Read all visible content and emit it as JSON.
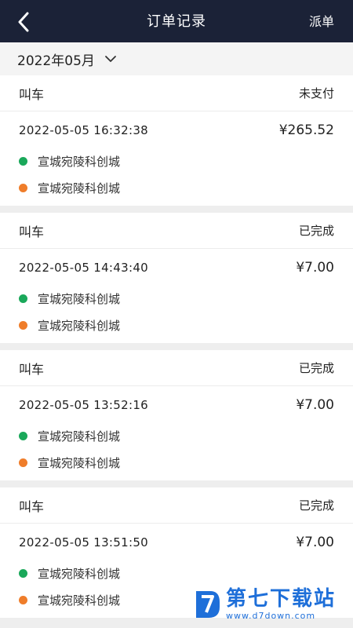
{
  "header": {
    "title": "订单记录",
    "action_label": "派单"
  },
  "month_filter": {
    "label": "2022年05月"
  },
  "orders": [
    {
      "type": "叫车",
      "status": "未支付",
      "time": "2022-05-05 16:32:38",
      "price": "¥265.52",
      "origin": "宣城宛陵科创城",
      "destination": "宣城宛陵科创城"
    },
    {
      "type": "叫车",
      "status": "已完成",
      "time": "2022-05-05 14:43:40",
      "price": "¥7.00",
      "origin": "宣城宛陵科创城",
      "destination": "宣城宛陵科创城"
    },
    {
      "type": "叫车",
      "status": "已完成",
      "time": "2022-05-05 13:52:16",
      "price": "¥7.00",
      "origin": "宣城宛陵科创城",
      "destination": "宣城宛陵科创城"
    },
    {
      "type": "叫车",
      "status": "已完成",
      "time": "2022-05-05 13:51:50",
      "price": "¥7.00",
      "origin": "宣城宛陵科创城",
      "destination": "宣城宛陵科创城"
    }
  ],
  "colors": {
    "header_bg": "#1b2237",
    "origin_dot": "#1aa85a",
    "destination_dot": "#ef7d2a",
    "watermark": "#1e6fd9"
  },
  "watermark": {
    "name": "第七下载站",
    "url": "www.d7down.com"
  }
}
